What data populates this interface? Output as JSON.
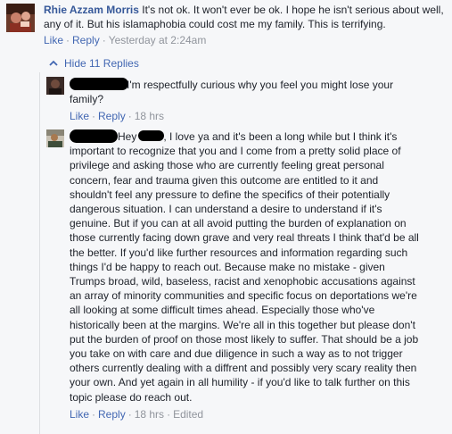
{
  "comment_main": {
    "author": "Rhie Azzam Morris",
    "text": "It's not ok. It won't ever be ok. I hope he isn't serious about well, any of it. But his islamaphobia could cost me my family. This is terrifying.",
    "like": "Like",
    "reply": "Reply",
    "time": "Yesterday at 2:24am"
  },
  "replies_toggle": {
    "label": "Hide 11 Replies",
    "icon": "chevron-up-icon"
  },
  "reply1": {
    "text": "I'm respectfully curious why you feel you might lose your family?",
    "like": "Like",
    "reply": "Reply",
    "time": "18 hrs"
  },
  "reply2": {
    "greeting": "Hey",
    "text_start": ", I love ya and it's been a long while but I think it's important to recognize that you and I come from a pretty solid place of privilege and asking those who are currently feeling great personal concern, fear and trauma given this outcome are entitled to it and shouldn't feel any pressure to define the specifics of their potentially dangerous situation. I can understand a desire to understand if it's genuine. But if you can at all avoid putting the burden of explanation on those currently facing down grave and very real threats I think that'd be all the better. If you'd like further resources and information regarding such things I'd be happy to reach out. Because make no mistake - given Trumps broad, wild, baseless, racist and xenophobic accusations against an array of minority communities and specific focus on deportations we're all looking at some difficult times ahead. Especially those who've historically been at the margins. We're all in this together but please don't put the burden of proof on those most likely to suffer. That should be a job you take on with care and due diligence in such a way as to not trigger others currently dealing with a diffrent and possibly very scary reality then your own. And yet again in all humility - if you'd like to talk further on this topic please do reach out.",
    "like": "Like",
    "reply": "Reply",
    "time": "18 hrs",
    "edited": "Edited"
  }
}
